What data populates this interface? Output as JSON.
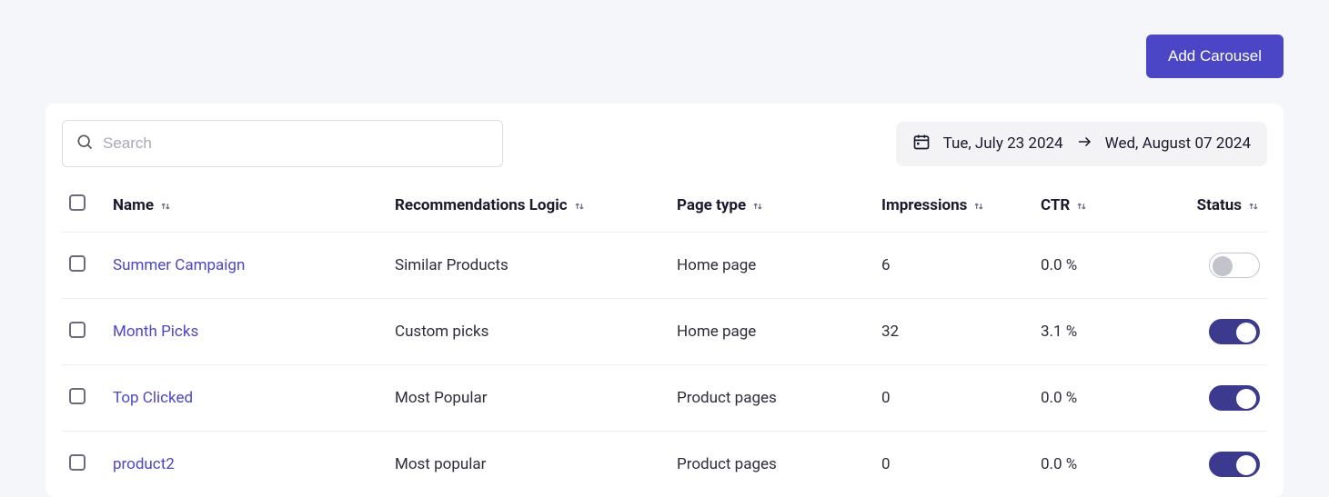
{
  "topbar": {
    "add_button": "Add Carousel"
  },
  "search": {
    "placeholder": "Search"
  },
  "date_range": {
    "from": "Tue, July 23 2024",
    "to": "Wed, August 07 2024"
  },
  "columns": {
    "name": "Name",
    "logic": "Recommendations Logic",
    "page_type": "Page type",
    "impressions": "Impressions",
    "ctr": "CTR",
    "status": "Status"
  },
  "rows": [
    {
      "name": "Summer Campaign",
      "logic": "Similar Products",
      "page_type": "Home page",
      "impressions": "6",
      "ctr": "0.0 %",
      "status": false
    },
    {
      "name": "Month Picks",
      "logic": "Custom picks",
      "page_type": "Home page",
      "impressions": "32",
      "ctr": "3.1 %",
      "status": true
    },
    {
      "name": "Top Clicked",
      "logic": "Most Popular",
      "page_type": "Product pages",
      "impressions": "0",
      "ctr": "0.0 %",
      "status": true
    },
    {
      "name": "product2",
      "logic": "Most popular",
      "page_type": "Product pages",
      "impressions": "0",
      "ctr": "0.0 %",
      "status": true
    }
  ]
}
